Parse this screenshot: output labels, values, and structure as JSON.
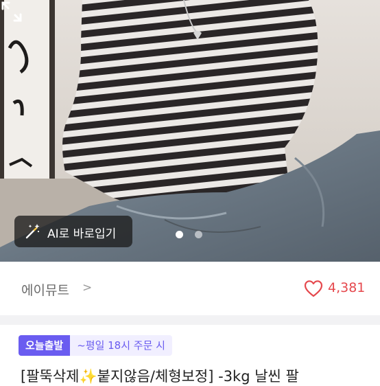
{
  "product_image": {
    "slide_index": 1,
    "slide_count": 2
  },
  "ai_button": {
    "label": "AI로 바로입기",
    "icon": "magic-wand-icon"
  },
  "expand_button": {
    "icon": "expand-icon"
  },
  "seller": {
    "name": "에이뮤트",
    "chevron": ">"
  },
  "likes": {
    "count": "4,381",
    "icon": "heart-icon",
    "color": "#e5484d"
  },
  "badges": {
    "today_ship": "오늘출발",
    "condition": "~평일 18시 주문 시",
    "accent": "#6a5cf0"
  },
  "product": {
    "title": "[팔뚝삭제✨붙지않음/체형보정] -3kg 날씬 팔"
  }
}
